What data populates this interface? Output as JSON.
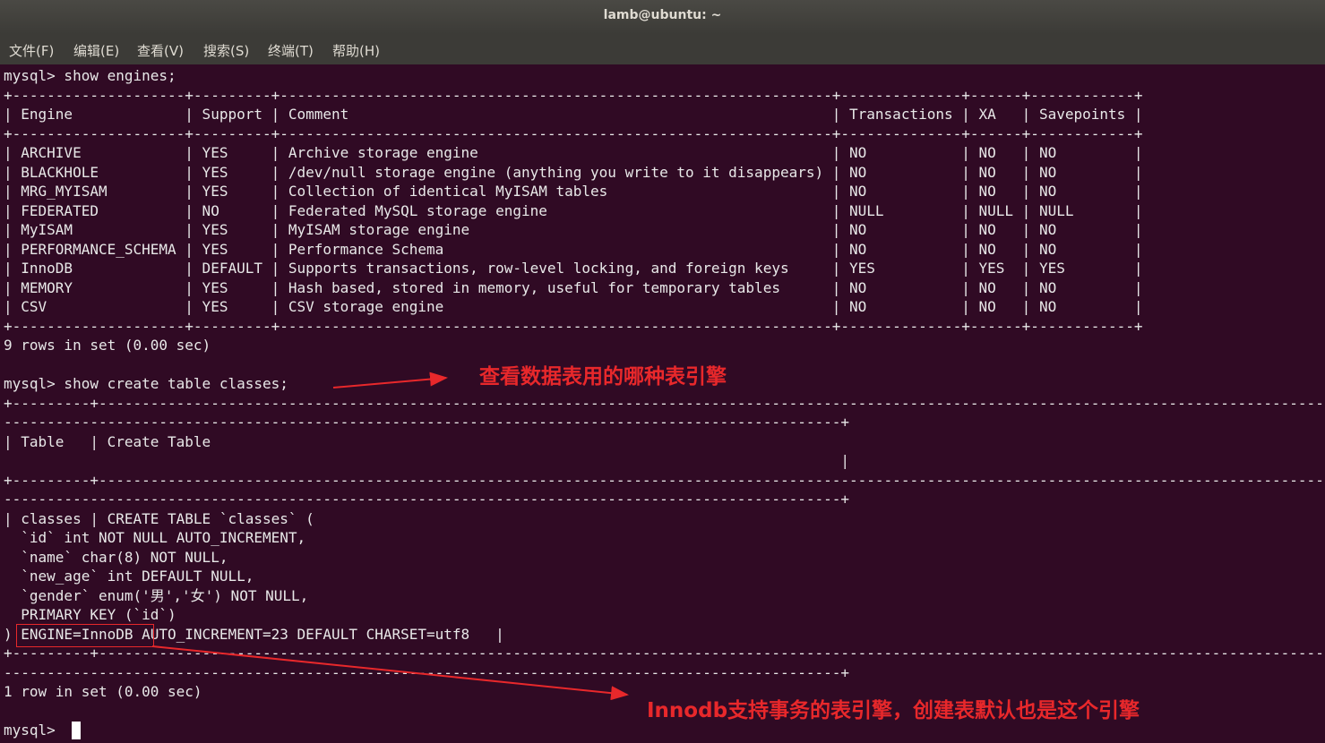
{
  "window": {
    "title": "lamb@ubuntu: ~"
  },
  "menu": [
    "文件(F)",
    "编辑(E)",
    "查看(V)",
    "搜索(S)",
    "终端(T)",
    "帮助(H)"
  ],
  "terminal": {
    "lines": [
      "mysql> show engines;",
      "+--------------------+---------+----------------------------------------------------------------+--------------+------+------------+",
      "| Engine             | Support | Comment                                                        | Transactions | XA   | Savepoints |",
      "+--------------------+---------+----------------------------------------------------------------+--------------+------+------------+",
      "| ARCHIVE            | YES     | Archive storage engine                                         | NO           | NO   | NO         |",
      "| BLACKHOLE          | YES     | /dev/null storage engine (anything you write to it disappears) | NO           | NO   | NO         |",
      "| MRG_MYISAM         | YES     | Collection of identical MyISAM tables                          | NO           | NO   | NO         |",
      "| FEDERATED          | NO      | Federated MySQL storage engine                                 | NULL         | NULL | NULL       |",
      "| MyISAM             | YES     | MyISAM storage engine                                          | NO           | NO   | NO         |",
      "| PERFORMANCE_SCHEMA | YES     | Performance Schema                                             | NO           | NO   | NO         |",
      "| InnoDB             | DEFAULT | Supports transactions, row-level locking, and foreign keys     | YES          | YES  | YES        |",
      "| MEMORY             | YES     | Hash based, stored in memory, useful for temporary tables      | NO           | NO   | NO         |",
      "| CSV                | YES     | CSV storage engine                                             | NO           | NO   | NO         |",
      "+--------------------+---------+----------------------------------------------------------------+--------------+------+------------+",
      "9 rows in set (0.00 sec)",
      "",
      "mysql> show create table classes;",
      "+---------+----------------------------------------------------------------------------------------------------------------------------------------------------",
      "-------------------------------------------------------------------------------------------------+",
      "| Table   | Create Table",
      "                                                                                                 |",
      "+---------+----------------------------------------------------------------------------------------------------------------------------------------------------",
      "-------------------------------------------------------------------------------------------------+",
      "| classes | CREATE TABLE `classes` (",
      "  `id` int NOT NULL AUTO_INCREMENT,",
      "  `name` char(8) NOT NULL,",
      "  `new_age` int DEFAULT NULL,",
      "  `gender` enum('男','女') NOT NULL,",
      "  PRIMARY KEY (`id`)",
      ") ENGINE=InnoDB AUTO_INCREMENT=23 DEFAULT CHARSET=utf8   |",
      "+---------+----------------------------------------------------------------------------------------------------------------------------------------------------",
      "-------------------------------------------------------------------------------------------------+",
      "1 row in set (0.00 sec)",
      "",
      "mysql> "
    ]
  },
  "annotations": {
    "note1": "查看数据表用的哪种表引擎",
    "note2": "Innodb支持事务的表引擎，创建表默认也是这个引擎"
  },
  "colors": {
    "annotation": "#e8282b",
    "terminal_bg": "#300a24"
  }
}
